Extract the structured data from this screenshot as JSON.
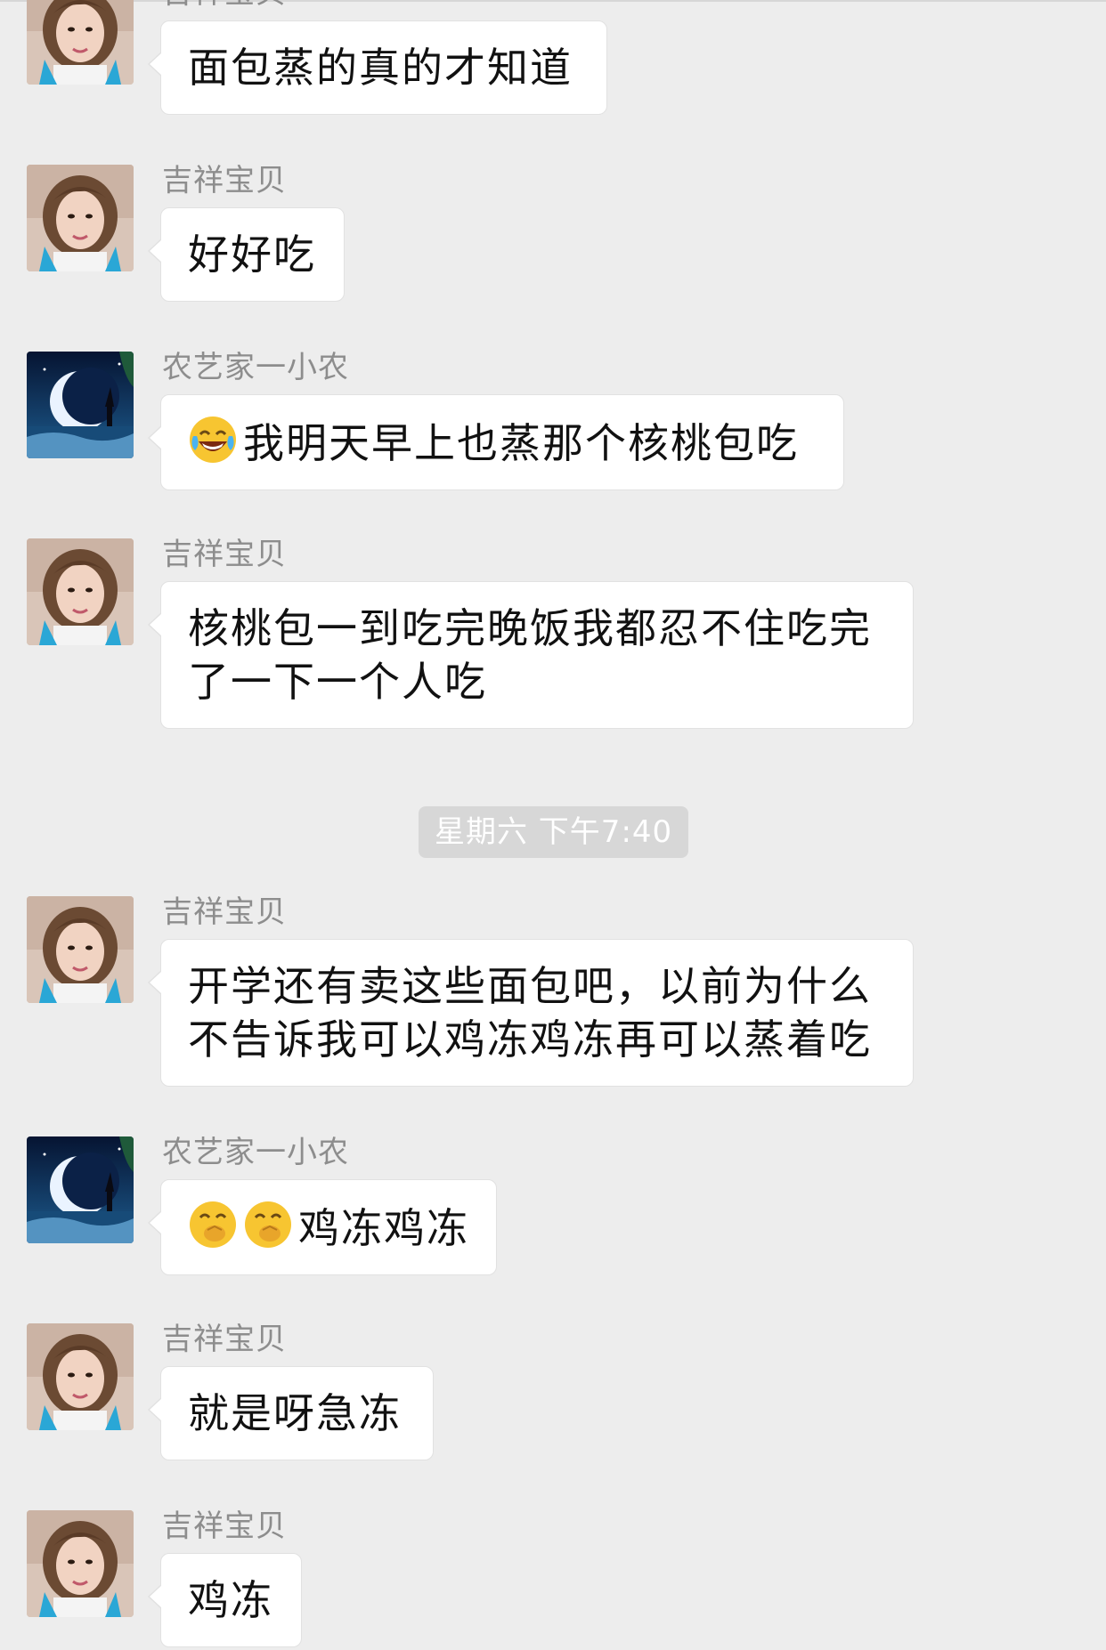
{
  "chat": {
    "messages": [
      {
        "sender": "吉祥宝贝",
        "avatar": "woman-portrait-avatar",
        "emojis": [],
        "text": "面包蒸的真的才知道"
      },
      {
        "sender": "吉祥宝贝",
        "avatar": "woman-portrait-avatar",
        "emojis": [],
        "text": "好好吃"
      },
      {
        "sender": "农艺家一小农",
        "avatar": "moon-night-avatar",
        "emojis": [
          "tears-of-joy-emoji"
        ],
        "text": "我明天早上也蒸那个核桃包吃"
      },
      {
        "sender": "吉祥宝贝",
        "avatar": "woman-portrait-avatar",
        "emojis": [],
        "text": "核桃包一到吃完晚饭我都忍不住吃完了一下一个人吃"
      },
      {
        "sender": "吉祥宝贝",
        "avatar": "woman-portrait-avatar",
        "emojis": [],
        "text": "开学还有卖这些面包吧，以前为什么不告诉我可以鸡冻鸡冻再可以蒸着吃"
      },
      {
        "sender": "农艺家一小农",
        "avatar": "moon-night-avatar",
        "emojis": [
          "hand-over-mouth-emoji",
          "hand-over-mouth-emoji"
        ],
        "text": "鸡冻鸡冻"
      },
      {
        "sender": "吉祥宝贝",
        "avatar": "woman-portrait-avatar",
        "emojis": [],
        "text": "就是呀急冻"
      },
      {
        "sender": "吉祥宝贝",
        "avatar": "woman-portrait-avatar",
        "emojis": [],
        "text": "鸡冻"
      }
    ],
    "timestamp": "星期六 下午7:40"
  },
  "colors": {
    "background": "#ededed",
    "bubble": "#ffffff",
    "sender_text": "#8d8d8d",
    "timestamp_bg": "#d7d7d7"
  }
}
